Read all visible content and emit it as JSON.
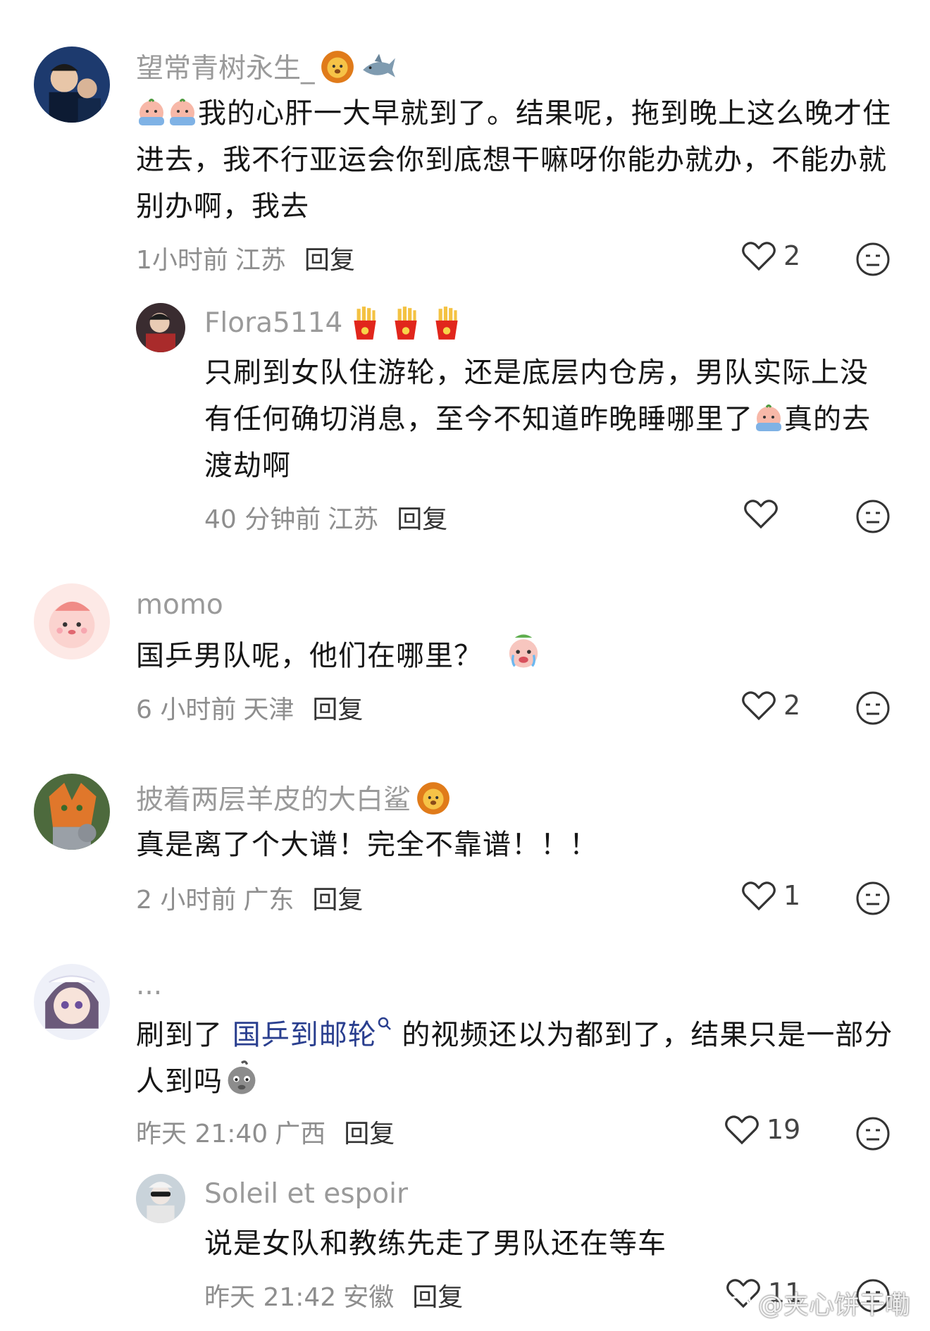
{
  "comments": [
    {
      "username": "望常青树永生_",
      "text_parts": [
        "我的心肝一大早就到了。结果呢，拖到晚上这么晚才住进去，我不行亚运会你到底想干嘛呀你能办就办，不能办就别办啊，我去"
      ],
      "time": "1小时前",
      "region": "江苏",
      "reply_label": "回复",
      "likes": "2"
    },
    {
      "username": "Flora5114",
      "text_before": "只刷到女队住游轮，还是底层内仓房，男队实际上没有任何确切消息，至今不知道昨晚睡哪里了",
      "text_after": "真的去渡劫啊",
      "time": "40 分钟前",
      "region": "江苏",
      "reply_label": "回复",
      "likes": ""
    },
    {
      "username": "momo",
      "text": "国乒男队呢，他们在哪里？",
      "time": "6 小时前",
      "region": "天津",
      "reply_label": "回复",
      "likes": "2"
    },
    {
      "username": "披着两层羊皮的大白鲨",
      "text": "真是离了个大谱！完全不靠谱！！！",
      "time": "2 小时前",
      "region": "广东",
      "reply_label": "回复",
      "likes": "1"
    },
    {
      "username": "...",
      "text_before": "刷到了 ",
      "link_text": "国乒到邮轮",
      "text_mid": " 的视频还以为都到了，结果只是一部分人到吗",
      "time": "昨天 21:40",
      "region": "广西",
      "reply_label": "回复",
      "likes": "19"
    },
    {
      "username": "Soleil et espoir",
      "text": "说是女队和教练先走了男队还在等车",
      "time": "昨天 21:42",
      "region": "安徽",
      "reply_label": "回复",
      "likes": "11"
    }
  ],
  "watermark": "@夹心饼干嘞",
  "colors": {
    "username": "#9a9a9a",
    "link": "#2a3f8f",
    "meta": "#8e8e8e"
  }
}
